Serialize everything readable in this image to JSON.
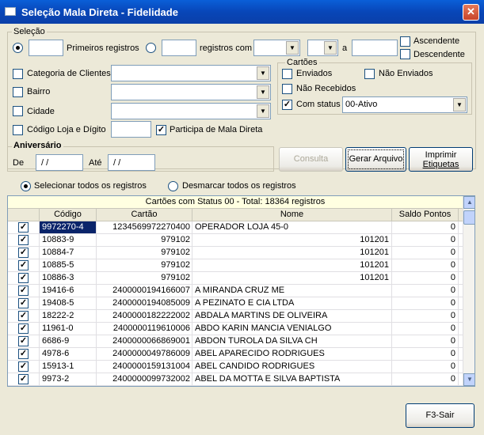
{
  "window": {
    "title": "Seleção Mala Direta - Fidelidade",
    "close": "✕"
  },
  "selecao": {
    "legend": "Seleção",
    "primeiros_label": "Primeiros registros",
    "primeiros_value": "",
    "registros_com_label": "registros com",
    "registros_com_value": "",
    "field_combo": "",
    "op_combo": "",
    "a_label": "a",
    "a_value": "",
    "ascendente": "Ascendente",
    "descendente": "Descendente"
  },
  "filters": {
    "categoria_label": "Categoria de Clientes",
    "bairro_label": "Bairro",
    "cidade_label": "Cidade",
    "codigo_loja_label": "Código Loja e Dígito",
    "codigo_loja_value": "",
    "participa_label": "Participa de Mala Direta"
  },
  "cartoes": {
    "legend": "Cartões",
    "enviados": "Enviados",
    "nao_enviados": "Não Enviados",
    "nao_recebidos": "Não Recebidos",
    "com_status": "Com status",
    "status_value": "00-Ativo"
  },
  "aniversario": {
    "legend": "Aniversário",
    "de_label": "De",
    "de_value": " / /",
    "ate_label": "Até",
    "ate_value": " / /"
  },
  "buttons": {
    "consulta": "Consulta",
    "gerar": "Gerar Arquivo",
    "imprimir_line1": "Imprimir",
    "imprimir_line2": "Etiquetas",
    "sair": "F3-Sair"
  },
  "selection": {
    "selecionar": "Selecionar todos os registros",
    "desmarcar": "Desmarcar todos os registros"
  },
  "grid": {
    "caption": "Cartões com Status 00 - Total: 18364 registros",
    "headers": [
      "",
      "Código",
      "Cartão",
      "Nome",
      "Saldo Pontos"
    ],
    "rows": [
      {
        "codigo": "9972270-4",
        "cartao": "1234569972270400",
        "nome": "OPERADOR LOJA 45-0",
        "nome_extra": "",
        "saldo": "0"
      },
      {
        "codigo": "10883-9",
        "cartao": "979102",
        "nome": "",
        "nome_extra": "101201",
        "saldo": "0"
      },
      {
        "codigo": "10884-7",
        "cartao": "979102",
        "nome": "",
        "nome_extra": "101201",
        "saldo": "0"
      },
      {
        "codigo": "10885-5",
        "cartao": "979102",
        "nome": "",
        "nome_extra": "101201",
        "saldo": "0"
      },
      {
        "codigo": "10886-3",
        "cartao": "979102",
        "nome": "",
        "nome_extra": "101201",
        "saldo": "0"
      },
      {
        "codigo": "19416-6",
        "cartao": "2400000194166007",
        "nome": "A MIRANDA CRUZ ME",
        "nome_extra": "",
        "saldo": "0"
      },
      {
        "codigo": "19408-5",
        "cartao": "2400000194085009",
        "nome": "A PEZINATO E CIA LTDA",
        "nome_extra": "",
        "saldo": "0"
      },
      {
        "codigo": "18222-2",
        "cartao": "2400000182222002",
        "nome": "ABDALA MARTINS DE OLIVEIRA",
        "nome_extra": "",
        "saldo": "0"
      },
      {
        "codigo": "11961-0",
        "cartao": "2400000119610006",
        "nome": "ABDO KARIN MANCIA VENIALGO",
        "nome_extra": "",
        "saldo": "0"
      },
      {
        "codigo": "6686-9",
        "cartao": "2400000066869001",
        "nome": "ABDON TUROLA DA SILVA CH",
        "nome_extra": "",
        "saldo": "0"
      },
      {
        "codigo": "4978-6",
        "cartao": "2400000049786009",
        "nome": "ABEL APARECIDO RODRIGUES",
        "nome_extra": "",
        "saldo": "0"
      },
      {
        "codigo": "15913-1",
        "cartao": "2400000159131004",
        "nome": "ABEL CANDIDO RODRIGUES",
        "nome_extra": "",
        "saldo": "0"
      },
      {
        "codigo": "9973-2",
        "cartao": "2400000099732002",
        "nome": "ABEL DA MOTTA E SILVA BAPTISTA",
        "nome_extra": "",
        "saldo": "0"
      }
    ]
  }
}
